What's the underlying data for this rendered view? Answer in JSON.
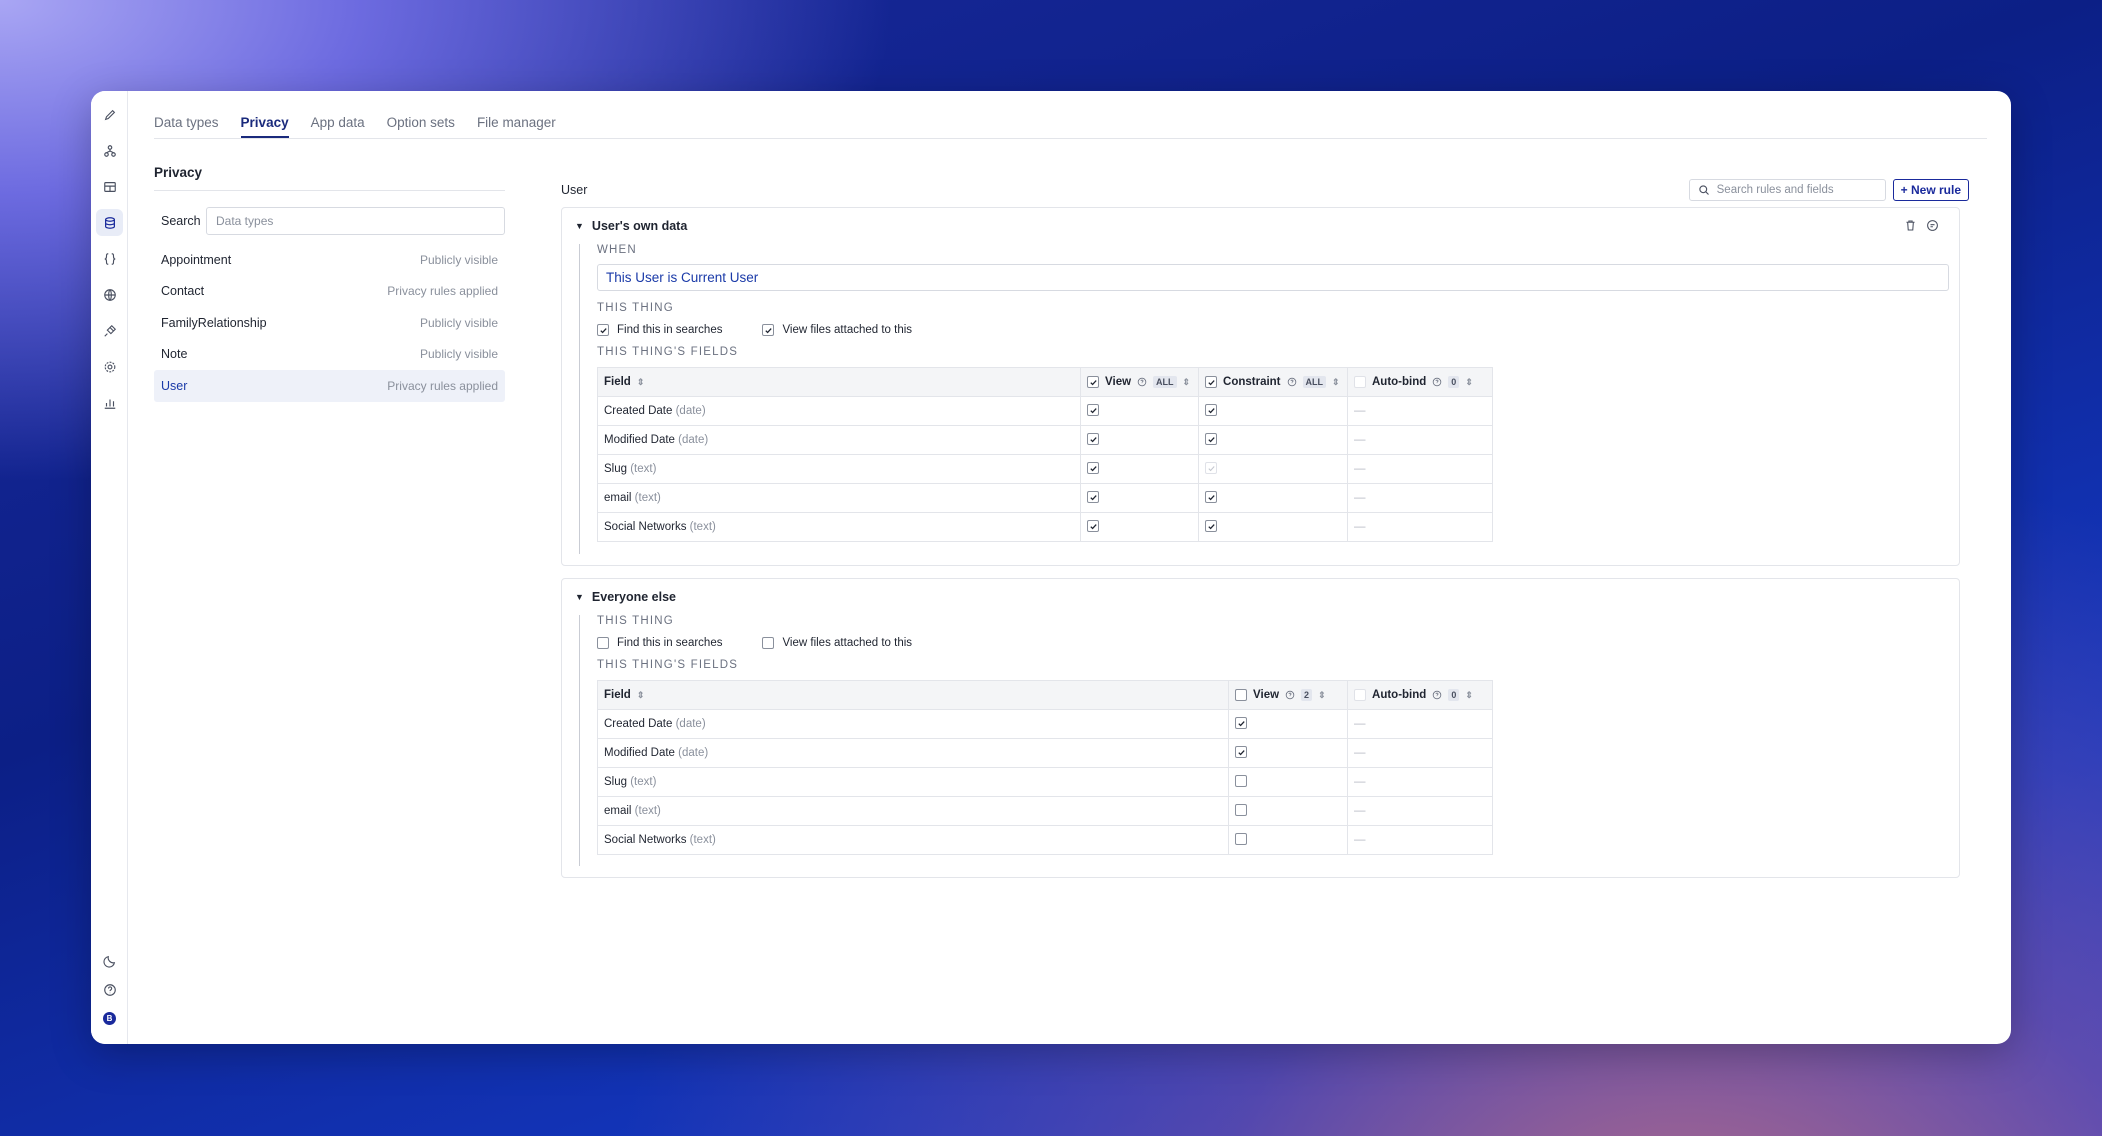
{
  "tabs": [
    {
      "label": "Data types"
    },
    {
      "label": "Privacy"
    },
    {
      "label": "App data"
    },
    {
      "label": "Option sets"
    },
    {
      "label": "File manager"
    }
  ],
  "left": {
    "title": "Privacy",
    "search_label": "Search",
    "search_placeholder": "Data types",
    "types": [
      {
        "name": "Appointment",
        "status": "Publicly visible"
      },
      {
        "name": "Contact",
        "status": "Privacy rules applied"
      },
      {
        "name": "FamilyRelationship",
        "status": "Publicly visible"
      },
      {
        "name": "Note",
        "status": "Publicly visible"
      },
      {
        "name": "User",
        "status": "Privacy rules applied"
      }
    ]
  },
  "right": {
    "crumb": "User",
    "rule_search_placeholder": "Search rules and fields",
    "new_rule_label": "+ New rule"
  },
  "rule1": {
    "title": "User's own data",
    "when_label": "When",
    "when_value": "This User is Current User",
    "this_thing_label": "This thing",
    "find_label": "Find this in searches",
    "files_label": "View files attached to this",
    "fields_label": "This thing's fields",
    "col_field": "Field",
    "col_view": "View",
    "col_constraint": "Constraint",
    "col_autobind": "Auto-bind",
    "view_pill": "ALL",
    "constraint_pill": "ALL",
    "autobind_pill": "0",
    "rows": [
      {
        "name": "Created Date",
        "type": "(date)",
        "view": true,
        "constraint": "checked",
        "autobind": "—"
      },
      {
        "name": "Modified Date",
        "type": "(date)",
        "view": true,
        "constraint": "checked",
        "autobind": "—"
      },
      {
        "name": "Slug",
        "type": "(text)",
        "view": true,
        "constraint": "faint",
        "autobind": "—"
      },
      {
        "name": "email",
        "type": "(text)",
        "view": true,
        "constraint": "checked",
        "autobind": "—"
      },
      {
        "name": "Social Networks",
        "type": "(text)",
        "view": true,
        "constraint": "checked",
        "autobind": "—"
      }
    ]
  },
  "rule2": {
    "title": "Everyone else",
    "this_thing_label": "This thing",
    "find_label": "Find this in searches",
    "files_label": "View files attached to this",
    "fields_label": "This thing's fields",
    "col_field": "Field",
    "col_view": "View",
    "col_autobind": "Auto-bind",
    "view_pill": "2",
    "autobind_pill": "0",
    "rows": [
      {
        "name": "Created Date",
        "type": "(date)",
        "view": true,
        "autobind": "—"
      },
      {
        "name": "Modified Date",
        "type": "(date)",
        "view": true,
        "autobind": "—"
      },
      {
        "name": "Slug",
        "type": "(text)",
        "view": false,
        "autobind": "—"
      },
      {
        "name": "email",
        "type": "(text)",
        "view": false,
        "autobind": "—"
      },
      {
        "name": "Social Networks",
        "type": "(text)",
        "view": false,
        "autobind": "—"
      }
    ]
  },
  "rail": {
    "items": [
      "pencil-icon",
      "workflow-icon",
      "layout-icon",
      "database-icon",
      "braces-icon",
      "globe-icon",
      "plug-icon",
      "settings-icon",
      "chart-icon"
    ],
    "bottom": [
      "moon-icon",
      "help-icon",
      "avatar"
    ],
    "avatar_letter": "B"
  },
  "colors": {
    "accent": "#1a2a9c",
    "link": "#1a3aa8"
  }
}
